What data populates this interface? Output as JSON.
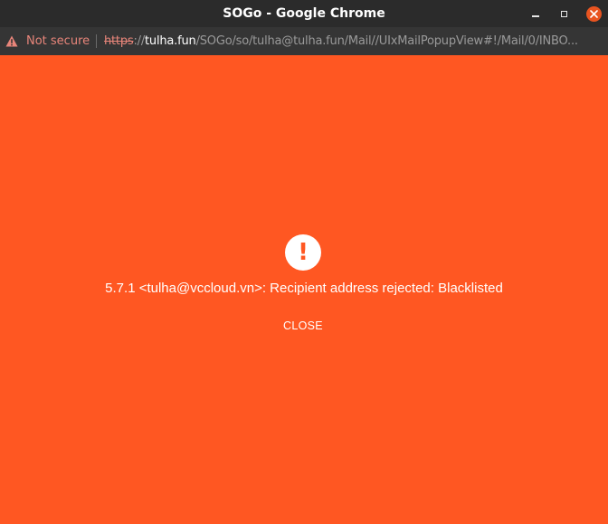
{
  "window": {
    "title": "SOGo - Google Chrome"
  },
  "addressbar": {
    "security_label": "Not secure",
    "url_scheme": "https",
    "url_separator": "://",
    "url_host": "tulha.fun",
    "url_path": "/SOGo/so/tulha@tulha.fun/Mail//UIxMailPopupView#!/Mail/0/INBO..."
  },
  "dialog": {
    "icon": "exclamation-icon",
    "message": "5.7.1 <tulha@vccloud.vn>: Recipient address rejected: Blacklisted",
    "close_label": "CLOSE"
  },
  "colors": {
    "background": "#ff5722",
    "titlebar": "#2b2b2b",
    "addressbar": "#353535",
    "insecure": "#e8857a",
    "close_button": "#e95420"
  }
}
